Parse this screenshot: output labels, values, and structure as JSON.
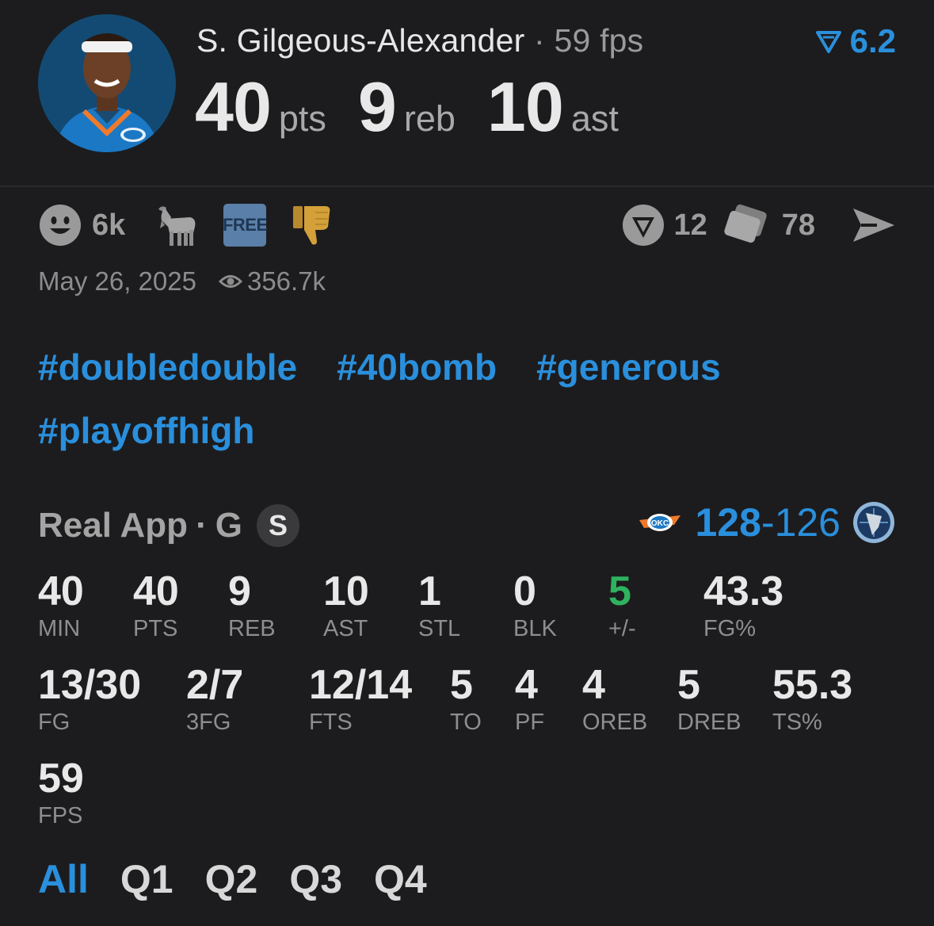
{
  "player": {
    "name": "S. Gilgeous-Alexander",
    "separator": "·",
    "fps_text": "59 fps",
    "rating": "6.2"
  },
  "headline": [
    {
      "value": "40",
      "unit": "pts"
    },
    {
      "value": "9",
      "unit": "reb"
    },
    {
      "value": "10",
      "unit": "ast"
    }
  ],
  "actions": {
    "reactions_count": "6k",
    "free_label": "FREE",
    "rank_count": "12",
    "cards_count": "78"
  },
  "meta": {
    "date": "May 26, 2025",
    "views": "356.7k"
  },
  "tags": [
    "#doubledouble",
    "#40bomb",
    "#generous",
    "#playoffhigh"
  ],
  "game": {
    "source": "Real App",
    "separator": "·",
    "position": "G",
    "badge": "S",
    "team_score": "128",
    "dash": "-",
    "opp_score": "126"
  },
  "stats": [
    {
      "value": "40",
      "label": "MIN"
    },
    {
      "value": "40",
      "label": "PTS"
    },
    {
      "value": "9",
      "label": "REB"
    },
    {
      "value": "10",
      "label": "AST"
    },
    {
      "value": "1",
      "label": "STL"
    },
    {
      "value": "0",
      "label": "BLK"
    },
    {
      "value": "5",
      "label": "+/-"
    },
    {
      "value": "43.3",
      "label": "FG%"
    },
    {
      "value": "13/30",
      "label": "FG"
    },
    {
      "value": "2/7",
      "label": "3FG"
    },
    {
      "value": "12/14",
      "label": "FTS"
    },
    {
      "value": "5",
      "label": "TO"
    },
    {
      "value": "4",
      "label": "PF"
    },
    {
      "value": "4",
      "label": "OREB"
    },
    {
      "value": "5",
      "label": "DREB"
    },
    {
      "value": "55.3",
      "label": "TS%"
    },
    {
      "value": "59",
      "label": "FPS"
    }
  ],
  "quarters": [
    "All",
    "Q1",
    "Q2",
    "Q3",
    "Q4"
  ],
  "colors": {
    "background": "#1c1c1e",
    "accent": "#2a8fdc",
    "positive": "#2fb25f",
    "muted": "#8e8e8e"
  }
}
